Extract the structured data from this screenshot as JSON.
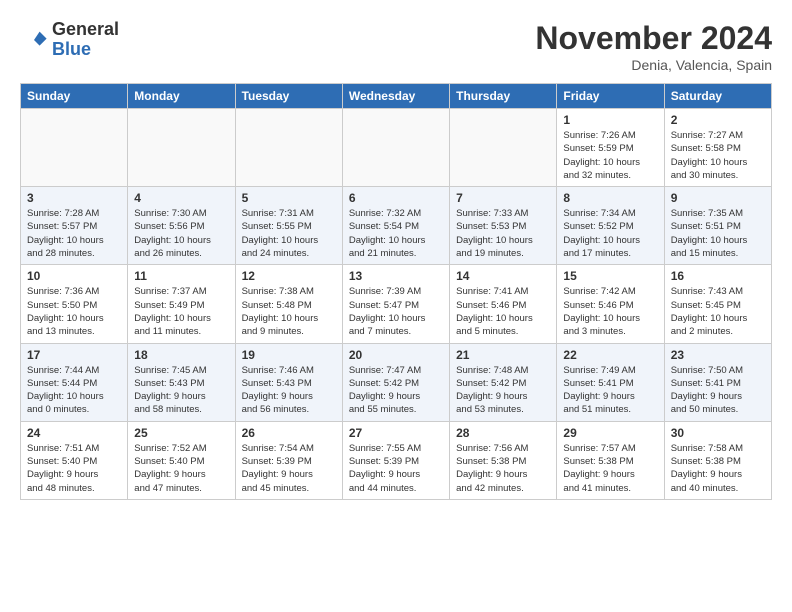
{
  "header": {
    "logo_line1": "General",
    "logo_line2": "Blue",
    "month": "November 2024",
    "location": "Denia, Valencia, Spain"
  },
  "days_of_week": [
    "Sunday",
    "Monday",
    "Tuesday",
    "Wednesday",
    "Thursday",
    "Friday",
    "Saturday"
  ],
  "weeks": [
    [
      {
        "day": "",
        "info": ""
      },
      {
        "day": "",
        "info": ""
      },
      {
        "day": "",
        "info": ""
      },
      {
        "day": "",
        "info": ""
      },
      {
        "day": "",
        "info": ""
      },
      {
        "day": "1",
        "info": "Sunrise: 7:26 AM\nSunset: 5:59 PM\nDaylight: 10 hours\nand 32 minutes."
      },
      {
        "day": "2",
        "info": "Sunrise: 7:27 AM\nSunset: 5:58 PM\nDaylight: 10 hours\nand 30 minutes."
      }
    ],
    [
      {
        "day": "3",
        "info": "Sunrise: 7:28 AM\nSunset: 5:57 PM\nDaylight: 10 hours\nand 28 minutes."
      },
      {
        "day": "4",
        "info": "Sunrise: 7:30 AM\nSunset: 5:56 PM\nDaylight: 10 hours\nand 26 minutes."
      },
      {
        "day": "5",
        "info": "Sunrise: 7:31 AM\nSunset: 5:55 PM\nDaylight: 10 hours\nand 24 minutes."
      },
      {
        "day": "6",
        "info": "Sunrise: 7:32 AM\nSunset: 5:54 PM\nDaylight: 10 hours\nand 21 minutes."
      },
      {
        "day": "7",
        "info": "Sunrise: 7:33 AM\nSunset: 5:53 PM\nDaylight: 10 hours\nand 19 minutes."
      },
      {
        "day": "8",
        "info": "Sunrise: 7:34 AM\nSunset: 5:52 PM\nDaylight: 10 hours\nand 17 minutes."
      },
      {
        "day": "9",
        "info": "Sunrise: 7:35 AM\nSunset: 5:51 PM\nDaylight: 10 hours\nand 15 minutes."
      }
    ],
    [
      {
        "day": "10",
        "info": "Sunrise: 7:36 AM\nSunset: 5:50 PM\nDaylight: 10 hours\nand 13 minutes."
      },
      {
        "day": "11",
        "info": "Sunrise: 7:37 AM\nSunset: 5:49 PM\nDaylight: 10 hours\nand 11 minutes."
      },
      {
        "day": "12",
        "info": "Sunrise: 7:38 AM\nSunset: 5:48 PM\nDaylight: 10 hours\nand 9 minutes."
      },
      {
        "day": "13",
        "info": "Sunrise: 7:39 AM\nSunset: 5:47 PM\nDaylight: 10 hours\nand 7 minutes."
      },
      {
        "day": "14",
        "info": "Sunrise: 7:41 AM\nSunset: 5:46 PM\nDaylight: 10 hours\nand 5 minutes."
      },
      {
        "day": "15",
        "info": "Sunrise: 7:42 AM\nSunset: 5:46 PM\nDaylight: 10 hours\nand 3 minutes."
      },
      {
        "day": "16",
        "info": "Sunrise: 7:43 AM\nSunset: 5:45 PM\nDaylight: 10 hours\nand 2 minutes."
      }
    ],
    [
      {
        "day": "17",
        "info": "Sunrise: 7:44 AM\nSunset: 5:44 PM\nDaylight: 10 hours\nand 0 minutes."
      },
      {
        "day": "18",
        "info": "Sunrise: 7:45 AM\nSunset: 5:43 PM\nDaylight: 9 hours\nand 58 minutes."
      },
      {
        "day": "19",
        "info": "Sunrise: 7:46 AM\nSunset: 5:43 PM\nDaylight: 9 hours\nand 56 minutes."
      },
      {
        "day": "20",
        "info": "Sunrise: 7:47 AM\nSunset: 5:42 PM\nDaylight: 9 hours\nand 55 minutes."
      },
      {
        "day": "21",
        "info": "Sunrise: 7:48 AM\nSunset: 5:42 PM\nDaylight: 9 hours\nand 53 minutes."
      },
      {
        "day": "22",
        "info": "Sunrise: 7:49 AM\nSunset: 5:41 PM\nDaylight: 9 hours\nand 51 minutes."
      },
      {
        "day": "23",
        "info": "Sunrise: 7:50 AM\nSunset: 5:41 PM\nDaylight: 9 hours\nand 50 minutes."
      }
    ],
    [
      {
        "day": "24",
        "info": "Sunrise: 7:51 AM\nSunset: 5:40 PM\nDaylight: 9 hours\nand 48 minutes."
      },
      {
        "day": "25",
        "info": "Sunrise: 7:52 AM\nSunset: 5:40 PM\nDaylight: 9 hours\nand 47 minutes."
      },
      {
        "day": "26",
        "info": "Sunrise: 7:54 AM\nSunset: 5:39 PM\nDaylight: 9 hours\nand 45 minutes."
      },
      {
        "day": "27",
        "info": "Sunrise: 7:55 AM\nSunset: 5:39 PM\nDaylight: 9 hours\nand 44 minutes."
      },
      {
        "day": "28",
        "info": "Sunrise: 7:56 AM\nSunset: 5:38 PM\nDaylight: 9 hours\nand 42 minutes."
      },
      {
        "day": "29",
        "info": "Sunrise: 7:57 AM\nSunset: 5:38 PM\nDaylight: 9 hours\nand 41 minutes."
      },
      {
        "day": "30",
        "info": "Sunrise: 7:58 AM\nSunset: 5:38 PM\nDaylight: 9 hours\nand 40 minutes."
      }
    ]
  ]
}
